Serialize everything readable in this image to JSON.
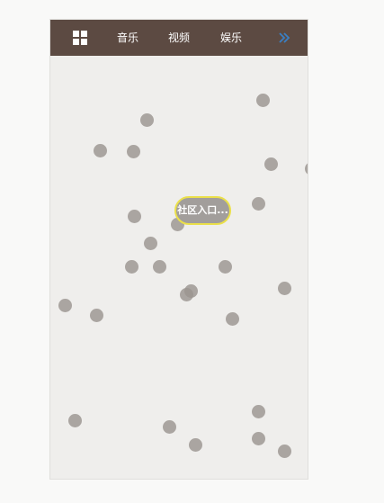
{
  "nav": {
    "menu_icon": "grid-icon",
    "items": [
      "音乐",
      "视频",
      "娱乐"
    ],
    "more_icon": "double-chevron-right-icon"
  },
  "community_button": {
    "label": "社区入口..."
  },
  "colors": {
    "topbar": "#5c4a42",
    "background": "#efeeec",
    "dot": "#9b9590",
    "button_border": "#ebe04a",
    "more_icon": "#3a7fc4"
  }
}
